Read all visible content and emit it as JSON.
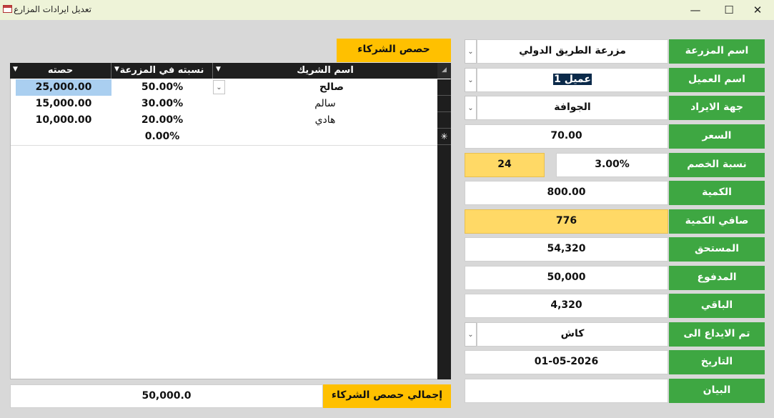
{
  "window": {
    "title": "تعديل ايرادات المزارع",
    "minimize_glyph": "—",
    "maximize_glyph": "☐",
    "close_glyph": "✕"
  },
  "form": {
    "farm_name": {
      "label": "اسم المزرعة",
      "value": "مزرعة الطريق الدولي"
    },
    "client_name": {
      "label": "اسم العميل",
      "value": "عميل 1"
    },
    "revenue_source": {
      "label": "جهة الايراد",
      "value": "الجوافة"
    },
    "price": {
      "label": "السعر",
      "value": "70.00"
    },
    "discount_rate": {
      "label": "نسبة الخصم",
      "value": "3.00%",
      "computed": "24"
    },
    "quantity": {
      "label": "الكمية",
      "value": "800.00"
    },
    "net_quantity": {
      "label": "صافي الكمية",
      "value": "776"
    },
    "due": {
      "label": "المستحق",
      "value": "54,320"
    },
    "paid": {
      "label": "المدفوع",
      "value": "50,000"
    },
    "remaining": {
      "label": "الباقي",
      "value": "4,320"
    },
    "deposited_to": {
      "label": "تم الايداع الى",
      "value": "كاش"
    },
    "date": {
      "label": "التاريخ",
      "value": "01-05-2026"
    },
    "statement": {
      "label": "البيان",
      "value": ""
    }
  },
  "partners": {
    "title": "حصص الشركاء",
    "columns": {
      "name": "اسم الشريك",
      "percent": "نسبته في المزرعة",
      "share": "حصته"
    },
    "rows": [
      {
        "name": "صالح",
        "percent": "50.00%",
        "share": "25,000.00"
      },
      {
        "name": "سالم",
        "percent": "30.00%",
        "share": "15,000.00"
      },
      {
        "name": "هادي",
        "percent": "20.00%",
        "share": "10,000.00"
      },
      {
        "name": "",
        "percent": "0.00%",
        "share": ""
      }
    ],
    "new_row_marker": "✳",
    "total_label": "إجمالي حصص الشركاء",
    "total_value": "50,000.0"
  },
  "colors": {
    "green": "#3ea742",
    "orange": "#ffc000",
    "yellow": "#ffd966",
    "selection": "#aacff0",
    "titlebar": "#eef3d8"
  }
}
